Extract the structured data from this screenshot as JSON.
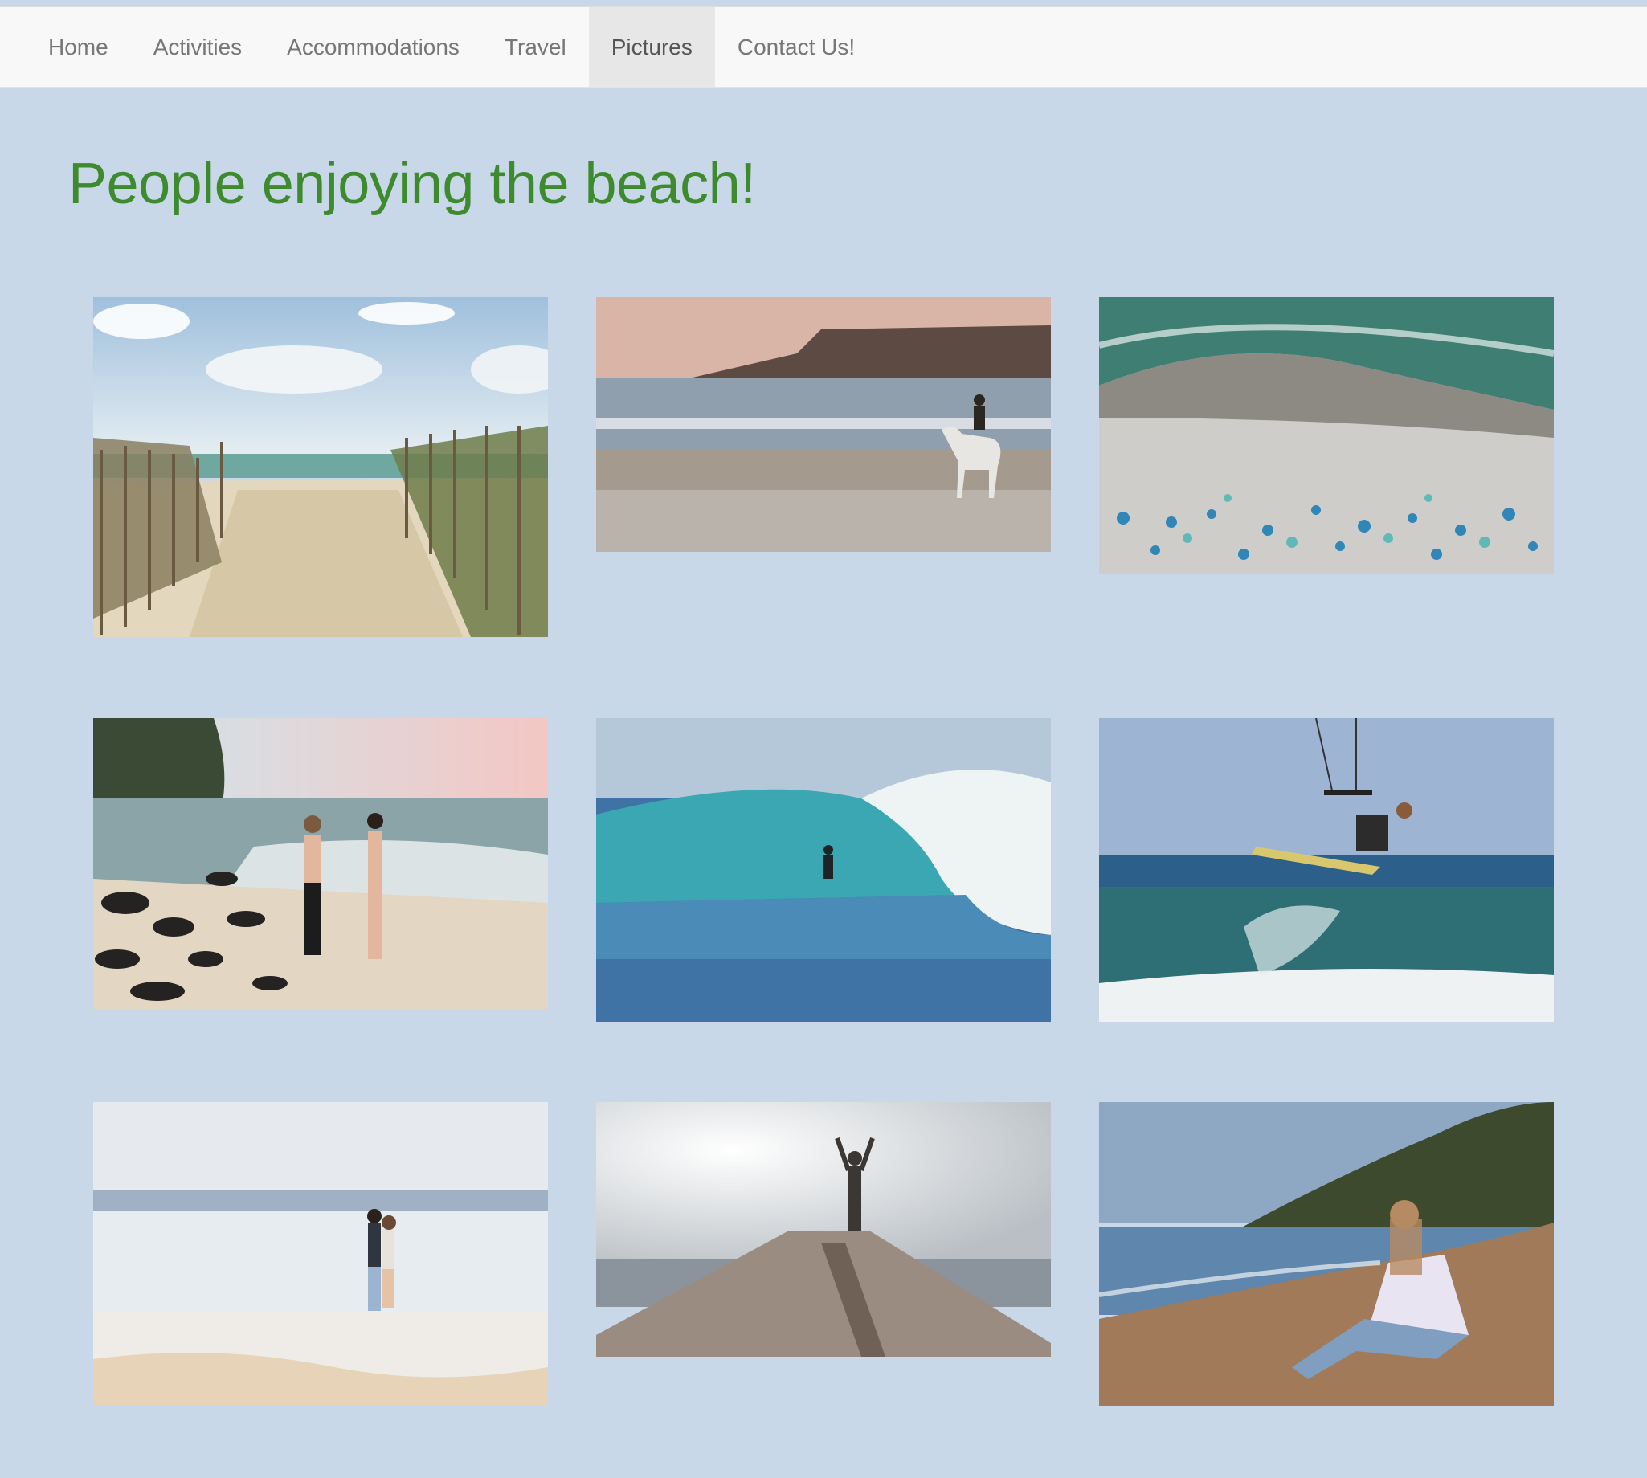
{
  "nav": {
    "items": [
      {
        "label": "Home"
      },
      {
        "label": "Activities"
      },
      {
        "label": "Accommodations"
      },
      {
        "label": "Travel"
      },
      {
        "label": "Pictures"
      },
      {
        "label": "Contact Us!"
      }
    ],
    "active_item": "Pictures"
  },
  "page": {
    "title": "People enjoying the beach!"
  },
  "gallery": {
    "photos": [
      {
        "icon": "beach-path-fence-photo"
      },
      {
        "icon": "horse-rider-beach-photo"
      },
      {
        "icon": "aerial-beach-umbrellas-photo"
      },
      {
        "icon": "couple-walking-rocky-beach-photo"
      },
      {
        "icon": "surfer-barrel-wave-photo"
      },
      {
        "icon": "kitesurfer-jump-photo"
      },
      {
        "icon": "couple-embracing-shore-photo"
      },
      {
        "icon": "yoga-pose-jetty-photo"
      },
      {
        "icon": "woman-sitting-sand-photo"
      }
    ]
  },
  "colors": {
    "background": "#c9d8e9",
    "title": "#3d8b2e",
    "navbar": "#f8f8f8",
    "nav_active": "#e7e7e7",
    "nav_text": "#777777"
  }
}
